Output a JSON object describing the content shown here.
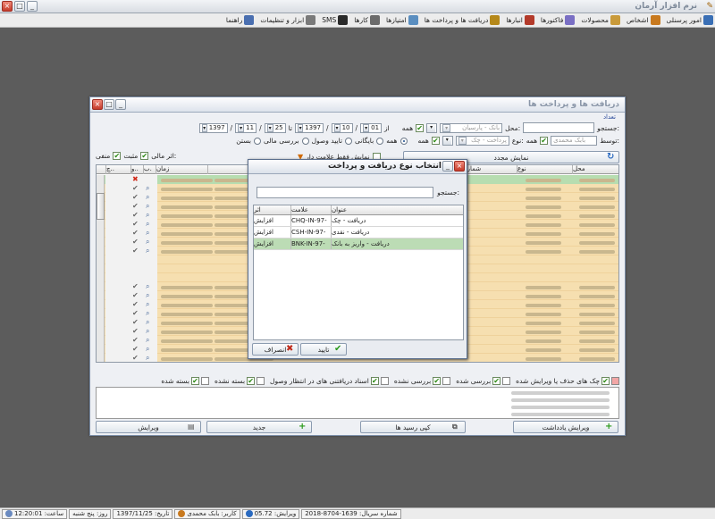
{
  "app": {
    "title": "نرم افزار آرمان"
  },
  "menu": [
    {
      "label": "امور پرسنلی",
      "icon": "personnel-icon",
      "color": "#3a6fb5"
    },
    {
      "label": "اشخاص",
      "icon": "people-icon",
      "color": "#c8791e"
    },
    {
      "label": "محصولات",
      "icon": "box-icon",
      "color": "#c99a3a"
    },
    {
      "label": "فاکتورها",
      "icon": "invoice-icon",
      "color": "#7a6fc4"
    },
    {
      "label": "انبارها",
      "icon": "warehouse-icon",
      "color": "#b33a2a"
    },
    {
      "label": "دریافت ها و پرداخت ها",
      "icon": "money-icon",
      "color": "#b5881a"
    },
    {
      "label": "امتیازها",
      "icon": "points-icon",
      "color": "#5a8ec0"
    },
    {
      "label": "کارها",
      "icon": "tasks-icon",
      "color": "#6b6b6b"
    },
    {
      "label": "SMS",
      "icon": "sms-icon",
      "color": "#2a2a2a"
    },
    {
      "label": "ابزار و تنظیمات",
      "icon": "tools-icon",
      "color": "#7a7a7a"
    },
    {
      "label": "راهنما",
      "icon": "help-icon",
      "color": "#4a6fb0"
    }
  ],
  "main_window": {
    "title": "دریافت ها و پرداخت ها",
    "count_label": "تعداد",
    "search_label": "جستجو:",
    "location_label": "محل:",
    "location_value": "بانک - پارسیان",
    "by_label": "توسط:",
    "by_value": "بابک محمدی",
    "type_label": "نوع:",
    "type_value": "پرداخت - چک",
    "all_label": "همه",
    "from_label": "از",
    "to_label": "تا",
    "date_from": {
      "year": "1397",
      "month": "10",
      "day": "01"
    },
    "date_to": {
      "year": "1397",
      "month": "11",
      "day": "25"
    },
    "status_radios": [
      "همه",
      "بایگانی",
      "تایید وصول",
      "بررسی مالی",
      "بستن"
    ],
    "effect_label": "اثر مالی:",
    "effect_positive": "مثبت",
    "effect_negative": "منفی",
    "show_marked": "نمایش فقط علامت دار",
    "refresh_button": "نمایش مجدد",
    "columns": [
      "محل",
      "نوع",
      "شماره",
      "زمان",
      "ب.",
      "و..",
      "چ.."
    ],
    "legend": [
      {
        "label": "چک های حذف یا ویرایش شده",
        "color": "#f2a6a6"
      },
      {
        "label": "بررسی شده",
        "color": "#ffffff"
      },
      {
        "label": "بررسی نشده",
        "color": "#ffffff"
      },
      {
        "label": "اسناد دریافتنی های در انتظار وصول",
        "color": "#ffffff"
      },
      {
        "label": "بسته نشده",
        "color": "#ffffff"
      },
      {
        "label": "بسته شده",
        "color": "#ffffff"
      }
    ],
    "buttons": {
      "edit_note": "ویرایش یادداشت",
      "copy_receipt": "کپی رسید ها",
      "new": "جدید",
      "edit": "ویرایش"
    }
  },
  "dialog": {
    "title": "انتخاب نوع دریافت و پرداخت",
    "search_label": "جستجو:",
    "columns": {
      "title": "عنوان",
      "code": "علامت",
      "effect": "اثر"
    },
    "rows": [
      {
        "title": "دریافت - چک",
        "code": "CHQ-IN-97-",
        "effect": "افزایش"
      },
      {
        "title": "دریافت - نقدی",
        "code": "CSH-IN-97-",
        "effect": "افزایش"
      },
      {
        "title": "دریافت - واریز به بانک",
        "code": "BNK-IN-97-",
        "effect": "افزایش"
      }
    ],
    "confirm": "تایید",
    "cancel": "انصراف"
  },
  "status": {
    "serial": "شماره سریال: 1639-8704-2018",
    "version": "ویرایش: 05.72",
    "user": "کاربر: بابک محمدی",
    "date": "تاریخ: 1397/11/25",
    "day": "روز: پنج شنبه",
    "time": "ساعت: 12:20:01"
  }
}
